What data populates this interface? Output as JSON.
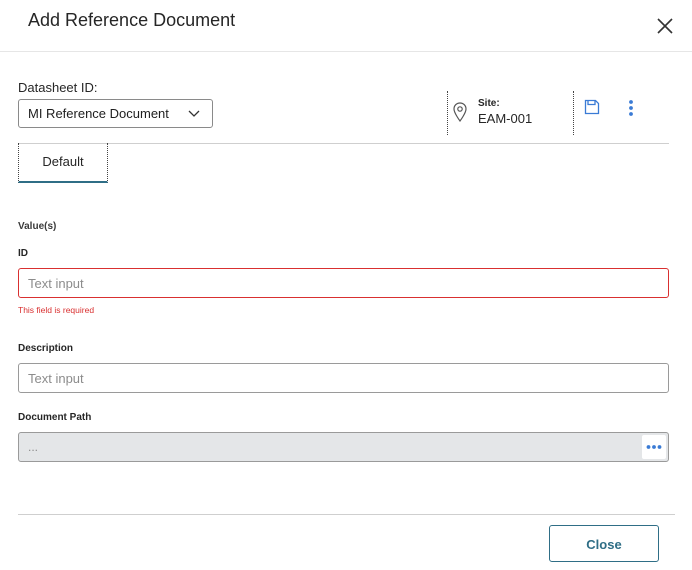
{
  "dialog": {
    "title": "Add Reference Document"
  },
  "datasheet": {
    "label": "Datasheet ID:",
    "selected": "MI Reference Document"
  },
  "site": {
    "label": "Site:",
    "value": "EAM-001"
  },
  "tabs": [
    {
      "label": "Default"
    }
  ],
  "form": {
    "section_label": "Value(s)",
    "id": {
      "label": "ID",
      "placeholder": "Text input",
      "error": "This field is required"
    },
    "description": {
      "label": "Description",
      "placeholder": "Text input"
    },
    "document_path": {
      "label": "Document Path",
      "value": "..."
    }
  },
  "footer": {
    "close_label": "Close"
  },
  "icons": {
    "close": "close-icon",
    "chevron": "chevron-down-icon",
    "location": "location-pin-icon",
    "save": "save-icon",
    "more": "more-vertical-icon",
    "browse": "ellipsis-icon"
  },
  "colors": {
    "accent": "#2f6e86",
    "error": "#d93030",
    "icon_blue": "#3a7bd5"
  }
}
